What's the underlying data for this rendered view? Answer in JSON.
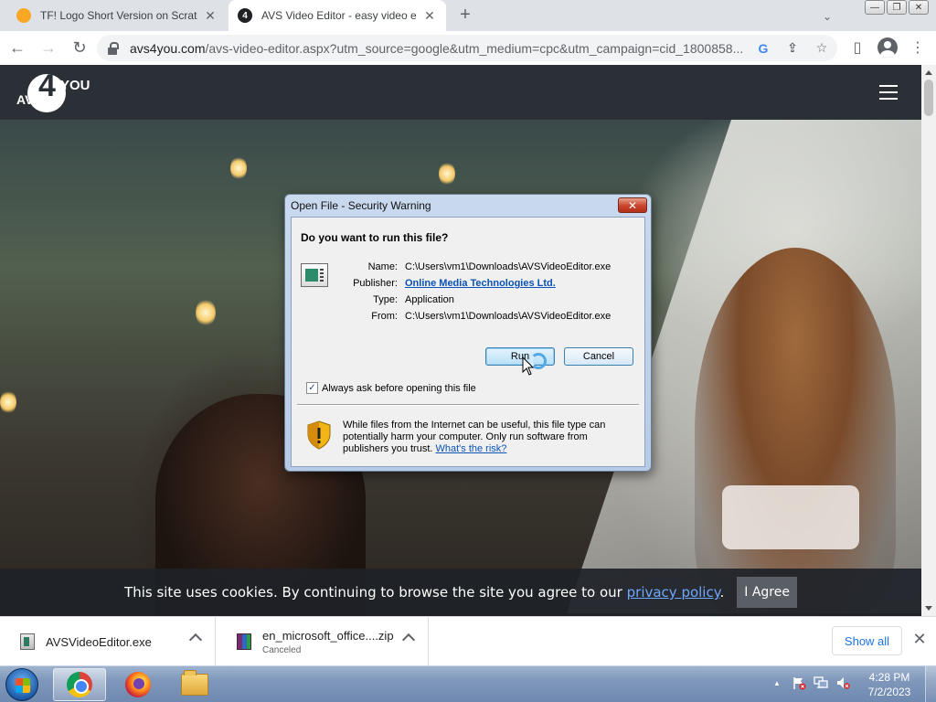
{
  "tabs": [
    {
      "title": "TF! Logo Short Version on Scratc",
      "close": "✕",
      "favicon": "scratch-icon",
      "color": "#f9a825"
    },
    {
      "title": "AVS Video Editor - easy video ed",
      "close": "✕",
      "favicon": "avs4you-icon",
      "favicon_text": "4",
      "color": "#202124"
    }
  ],
  "tabstrip": {
    "new_tab": "+",
    "tab_search": "⌄"
  },
  "window_controls": [
    "—",
    "❐",
    "✕"
  ],
  "toolbar": {
    "back": "←",
    "forward": "→",
    "reload": "↻",
    "url_host": "avs4you.com",
    "url_rest": "/avs-video-editor.aspx?utm_source=google&utm_medium=cpc&utm_campaign=cid_1800858...",
    "google_icon": "G",
    "share_icon": "⇪",
    "bookmark_icon": "☆",
    "sidepanel_icon": "▯",
    "menu_icon": "⋮"
  },
  "site": {
    "logo_avs": "AVS",
    "logo_four": "4",
    "logo_you": "YOU"
  },
  "cookie": {
    "text": "This site uses cookies. By continuing to browse the site you agree to our ",
    "link": "privacy policy",
    "end": ".",
    "agree": "I Agree"
  },
  "dialog": {
    "title": "Open File - Security Warning",
    "close": "✕",
    "question": "Do you want to run this file?",
    "fields": [
      {
        "label": "Name:",
        "value": "C:\\Users\\vm1\\Downloads\\AVSVideoEditor.exe"
      },
      {
        "label": "Publisher:",
        "value": "Online Media Technologies Ltd."
      },
      {
        "label": "Type:",
        "value": "Application"
      },
      {
        "label": "From:",
        "value": "C:\\Users\\vm1\\Downloads\\AVSVideoEditor.exe"
      }
    ],
    "run": "Run",
    "cancel": "Cancel",
    "checkbox_label": "Always ask before opening this file",
    "checkbox_checked": "✓",
    "warning": "While files from the Internet can be useful, this file type can potentially harm your computer. Only run software from publishers you trust. ",
    "risk_link": "What's the risk?"
  },
  "downloads": [
    {
      "name": "AVSVideoEditor.exe",
      "status": ""
    },
    {
      "name": "en_microsoft_office....zip",
      "status": "Canceled"
    }
  ],
  "shelf": {
    "show_all": "Show all",
    "close": "✕"
  },
  "taskbar": {
    "tray_up": "▲",
    "clock_time": "4:28 PM",
    "clock_date": "7/2/2023"
  }
}
